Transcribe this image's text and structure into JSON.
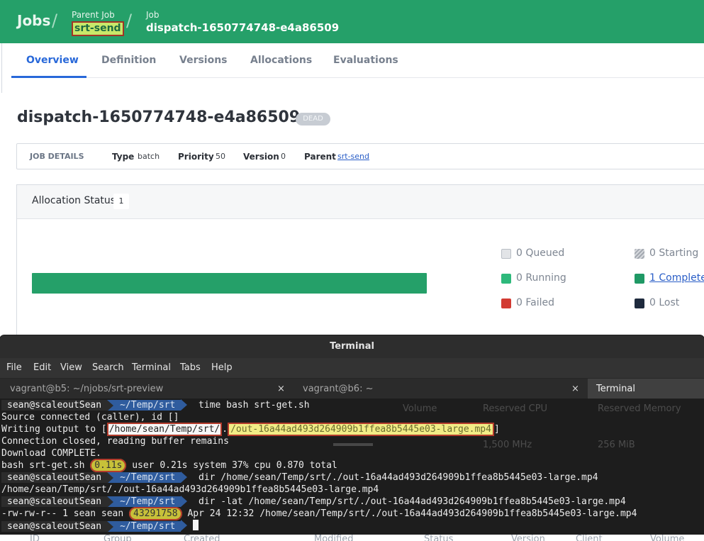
{
  "header": {
    "jobs_link": "Jobs",
    "separator": "/",
    "parent_label": "Parent Job",
    "parent_value": "srt-send",
    "job_label": "Job",
    "job_value": "dispatch-1650774748-e4a86509"
  },
  "tabs": [
    {
      "label": "Overview",
      "active": true
    },
    {
      "label": "Definition"
    },
    {
      "label": "Versions"
    },
    {
      "label": "Allocations"
    },
    {
      "label": "Evaluations"
    }
  ],
  "job": {
    "title": "dispatch-1650774748-e4a86509",
    "status_badge": "DEAD"
  },
  "job_details": {
    "heading": "JOB DETAILS",
    "type_label": "Type",
    "type_value": "batch",
    "priority_label": "Priority",
    "priority_value": "50",
    "version_label": "Version",
    "version_value": "0",
    "parent_label": "Parent",
    "parent_value": "srt-send"
  },
  "allocation_status": {
    "title": "Allocation Status",
    "count": "1",
    "complete_fraction": 1.0,
    "legend": [
      {
        "label": "0 Queued",
        "color": "#e2e4e7"
      },
      {
        "label": "0 Starting",
        "color": "#b7bcc3"
      },
      {
        "label": "0 Running",
        "color": "#2eb97b"
      },
      {
        "label": "1 Complete",
        "color": "#1f9965"
      },
      {
        "label": "0 Failed",
        "color": "#d23b32"
      },
      {
        "label": "0 Lost",
        "color": "#1e2a3d"
      }
    ]
  },
  "background_table": {
    "headers_top": [
      "Volume",
      "Reserved CPU",
      "Reserved Memory"
    ],
    "row_values": [
      "1,500 MHz",
      "256 MiB"
    ],
    "headers_bottom": [
      "ID",
      "Group",
      "Created",
      "Modified",
      "Status",
      "Version",
      "Client",
      "Volume"
    ]
  },
  "terminal": {
    "title": "Terminal",
    "menu": [
      "File",
      "Edit",
      "View",
      "Search",
      "Terminal",
      "Tabs",
      "Help"
    ],
    "tabs": [
      {
        "label": "vagrant@b5: ~/njobs/srt-preview",
        "close": "×"
      },
      {
        "label": "vagrant@b6: ~",
        "close": "×"
      },
      {
        "label": "Terminal",
        "active": true
      }
    ],
    "prompt_user": "sean@scaleoutSean",
    "prompt_dir": "~/Temp/srt",
    "lines": {
      "cmd1": "time bash srt-get.sh",
      "out1": "Source connected (caller), id []",
      "out2_prefix": "Writing output to [",
      "out2_path": "/home/sean/Temp/srt/",
      "out2_dot": ".",
      "out2_file": "/out-16a44ad493d264909b1ffea8b5445e03-large.mp4",
      "out2_suffix": "]",
      "out3": "Connection closed, reading buffer remains",
      "out4": "Download COMPLETE.",
      "time_prefix": "bash srt-get.sh ",
      "time_value": "0.11s",
      "time_suffix": " user 0.21s system 37% cpu 0.870 total",
      "cmd2": "dir /home/sean/Temp/srt/./out-16a44ad493d264909b1ffea8b5445e03-large.mp4",
      "out5": "/home/sean/Temp/srt/./out-16a44ad493d264909b1ffea8b5445e03-large.mp4",
      "cmd3": "dir -lat /home/sean/Temp/srt/./out-16a44ad493d264909b1ffea8b5445e03-large.mp4",
      "ls_prefix": "-rw-rw-r-- 1 sean sean ",
      "ls_size": "43291758",
      "ls_suffix": " Apr 24 12:32 /home/sean/Temp/srt/./out-16a44ad493d264909b1ffea8b5445e03-large.mp4"
    }
  }
}
